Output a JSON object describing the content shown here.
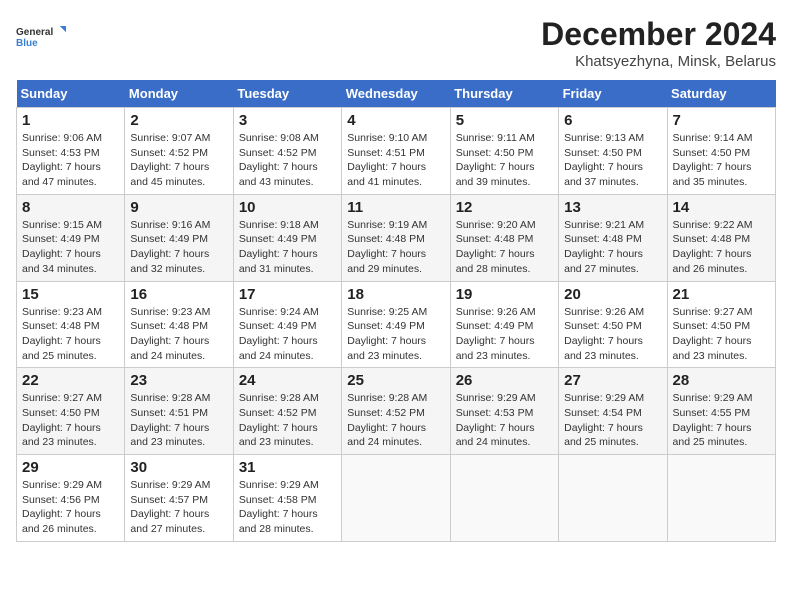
{
  "logo": {
    "line1": "General",
    "line2": "Blue"
  },
  "title": "December 2024",
  "subtitle": "Khatsyezhyna, Minsk, Belarus",
  "days_of_week": [
    "Sunday",
    "Monday",
    "Tuesday",
    "Wednesday",
    "Thursday",
    "Friday",
    "Saturday"
  ],
  "weeks": [
    [
      {
        "day": "1",
        "info": "Sunrise: 9:06 AM\nSunset: 4:53 PM\nDaylight: 7 hours\nand 47 minutes."
      },
      {
        "day": "2",
        "info": "Sunrise: 9:07 AM\nSunset: 4:52 PM\nDaylight: 7 hours\nand 45 minutes."
      },
      {
        "day": "3",
        "info": "Sunrise: 9:08 AM\nSunset: 4:52 PM\nDaylight: 7 hours\nand 43 minutes."
      },
      {
        "day": "4",
        "info": "Sunrise: 9:10 AM\nSunset: 4:51 PM\nDaylight: 7 hours\nand 41 minutes."
      },
      {
        "day": "5",
        "info": "Sunrise: 9:11 AM\nSunset: 4:50 PM\nDaylight: 7 hours\nand 39 minutes."
      },
      {
        "day": "6",
        "info": "Sunrise: 9:13 AM\nSunset: 4:50 PM\nDaylight: 7 hours\nand 37 minutes."
      },
      {
        "day": "7",
        "info": "Sunrise: 9:14 AM\nSunset: 4:50 PM\nDaylight: 7 hours\nand 35 minutes."
      }
    ],
    [
      {
        "day": "8",
        "info": "Sunrise: 9:15 AM\nSunset: 4:49 PM\nDaylight: 7 hours\nand 34 minutes."
      },
      {
        "day": "9",
        "info": "Sunrise: 9:16 AM\nSunset: 4:49 PM\nDaylight: 7 hours\nand 32 minutes."
      },
      {
        "day": "10",
        "info": "Sunrise: 9:18 AM\nSunset: 4:49 PM\nDaylight: 7 hours\nand 31 minutes."
      },
      {
        "day": "11",
        "info": "Sunrise: 9:19 AM\nSunset: 4:48 PM\nDaylight: 7 hours\nand 29 minutes."
      },
      {
        "day": "12",
        "info": "Sunrise: 9:20 AM\nSunset: 4:48 PM\nDaylight: 7 hours\nand 28 minutes."
      },
      {
        "day": "13",
        "info": "Sunrise: 9:21 AM\nSunset: 4:48 PM\nDaylight: 7 hours\nand 27 minutes."
      },
      {
        "day": "14",
        "info": "Sunrise: 9:22 AM\nSunset: 4:48 PM\nDaylight: 7 hours\nand 26 minutes."
      }
    ],
    [
      {
        "day": "15",
        "info": "Sunrise: 9:23 AM\nSunset: 4:48 PM\nDaylight: 7 hours\nand 25 minutes."
      },
      {
        "day": "16",
        "info": "Sunrise: 9:23 AM\nSunset: 4:48 PM\nDaylight: 7 hours\nand 24 minutes."
      },
      {
        "day": "17",
        "info": "Sunrise: 9:24 AM\nSunset: 4:49 PM\nDaylight: 7 hours\nand 24 minutes."
      },
      {
        "day": "18",
        "info": "Sunrise: 9:25 AM\nSunset: 4:49 PM\nDaylight: 7 hours\nand 23 minutes."
      },
      {
        "day": "19",
        "info": "Sunrise: 9:26 AM\nSunset: 4:49 PM\nDaylight: 7 hours\nand 23 minutes."
      },
      {
        "day": "20",
        "info": "Sunrise: 9:26 AM\nSunset: 4:50 PM\nDaylight: 7 hours\nand 23 minutes."
      },
      {
        "day": "21",
        "info": "Sunrise: 9:27 AM\nSunset: 4:50 PM\nDaylight: 7 hours\nand 23 minutes."
      }
    ],
    [
      {
        "day": "22",
        "info": "Sunrise: 9:27 AM\nSunset: 4:50 PM\nDaylight: 7 hours\nand 23 minutes."
      },
      {
        "day": "23",
        "info": "Sunrise: 9:28 AM\nSunset: 4:51 PM\nDaylight: 7 hours\nand 23 minutes."
      },
      {
        "day": "24",
        "info": "Sunrise: 9:28 AM\nSunset: 4:52 PM\nDaylight: 7 hours\nand 23 minutes."
      },
      {
        "day": "25",
        "info": "Sunrise: 9:28 AM\nSunset: 4:52 PM\nDaylight: 7 hours\nand 24 minutes."
      },
      {
        "day": "26",
        "info": "Sunrise: 9:29 AM\nSunset: 4:53 PM\nDaylight: 7 hours\nand 24 minutes."
      },
      {
        "day": "27",
        "info": "Sunrise: 9:29 AM\nSunset: 4:54 PM\nDaylight: 7 hours\nand 25 minutes."
      },
      {
        "day": "28",
        "info": "Sunrise: 9:29 AM\nSunset: 4:55 PM\nDaylight: 7 hours\nand 25 minutes."
      }
    ],
    [
      {
        "day": "29",
        "info": "Sunrise: 9:29 AM\nSunset: 4:56 PM\nDaylight: 7 hours\nand 26 minutes."
      },
      {
        "day": "30",
        "info": "Sunrise: 9:29 AM\nSunset: 4:57 PM\nDaylight: 7 hours\nand 27 minutes."
      },
      {
        "day": "31",
        "info": "Sunrise: 9:29 AM\nSunset: 4:58 PM\nDaylight: 7 hours\nand 28 minutes."
      },
      {
        "day": "",
        "info": ""
      },
      {
        "day": "",
        "info": ""
      },
      {
        "day": "",
        "info": ""
      },
      {
        "day": "",
        "info": ""
      }
    ]
  ]
}
